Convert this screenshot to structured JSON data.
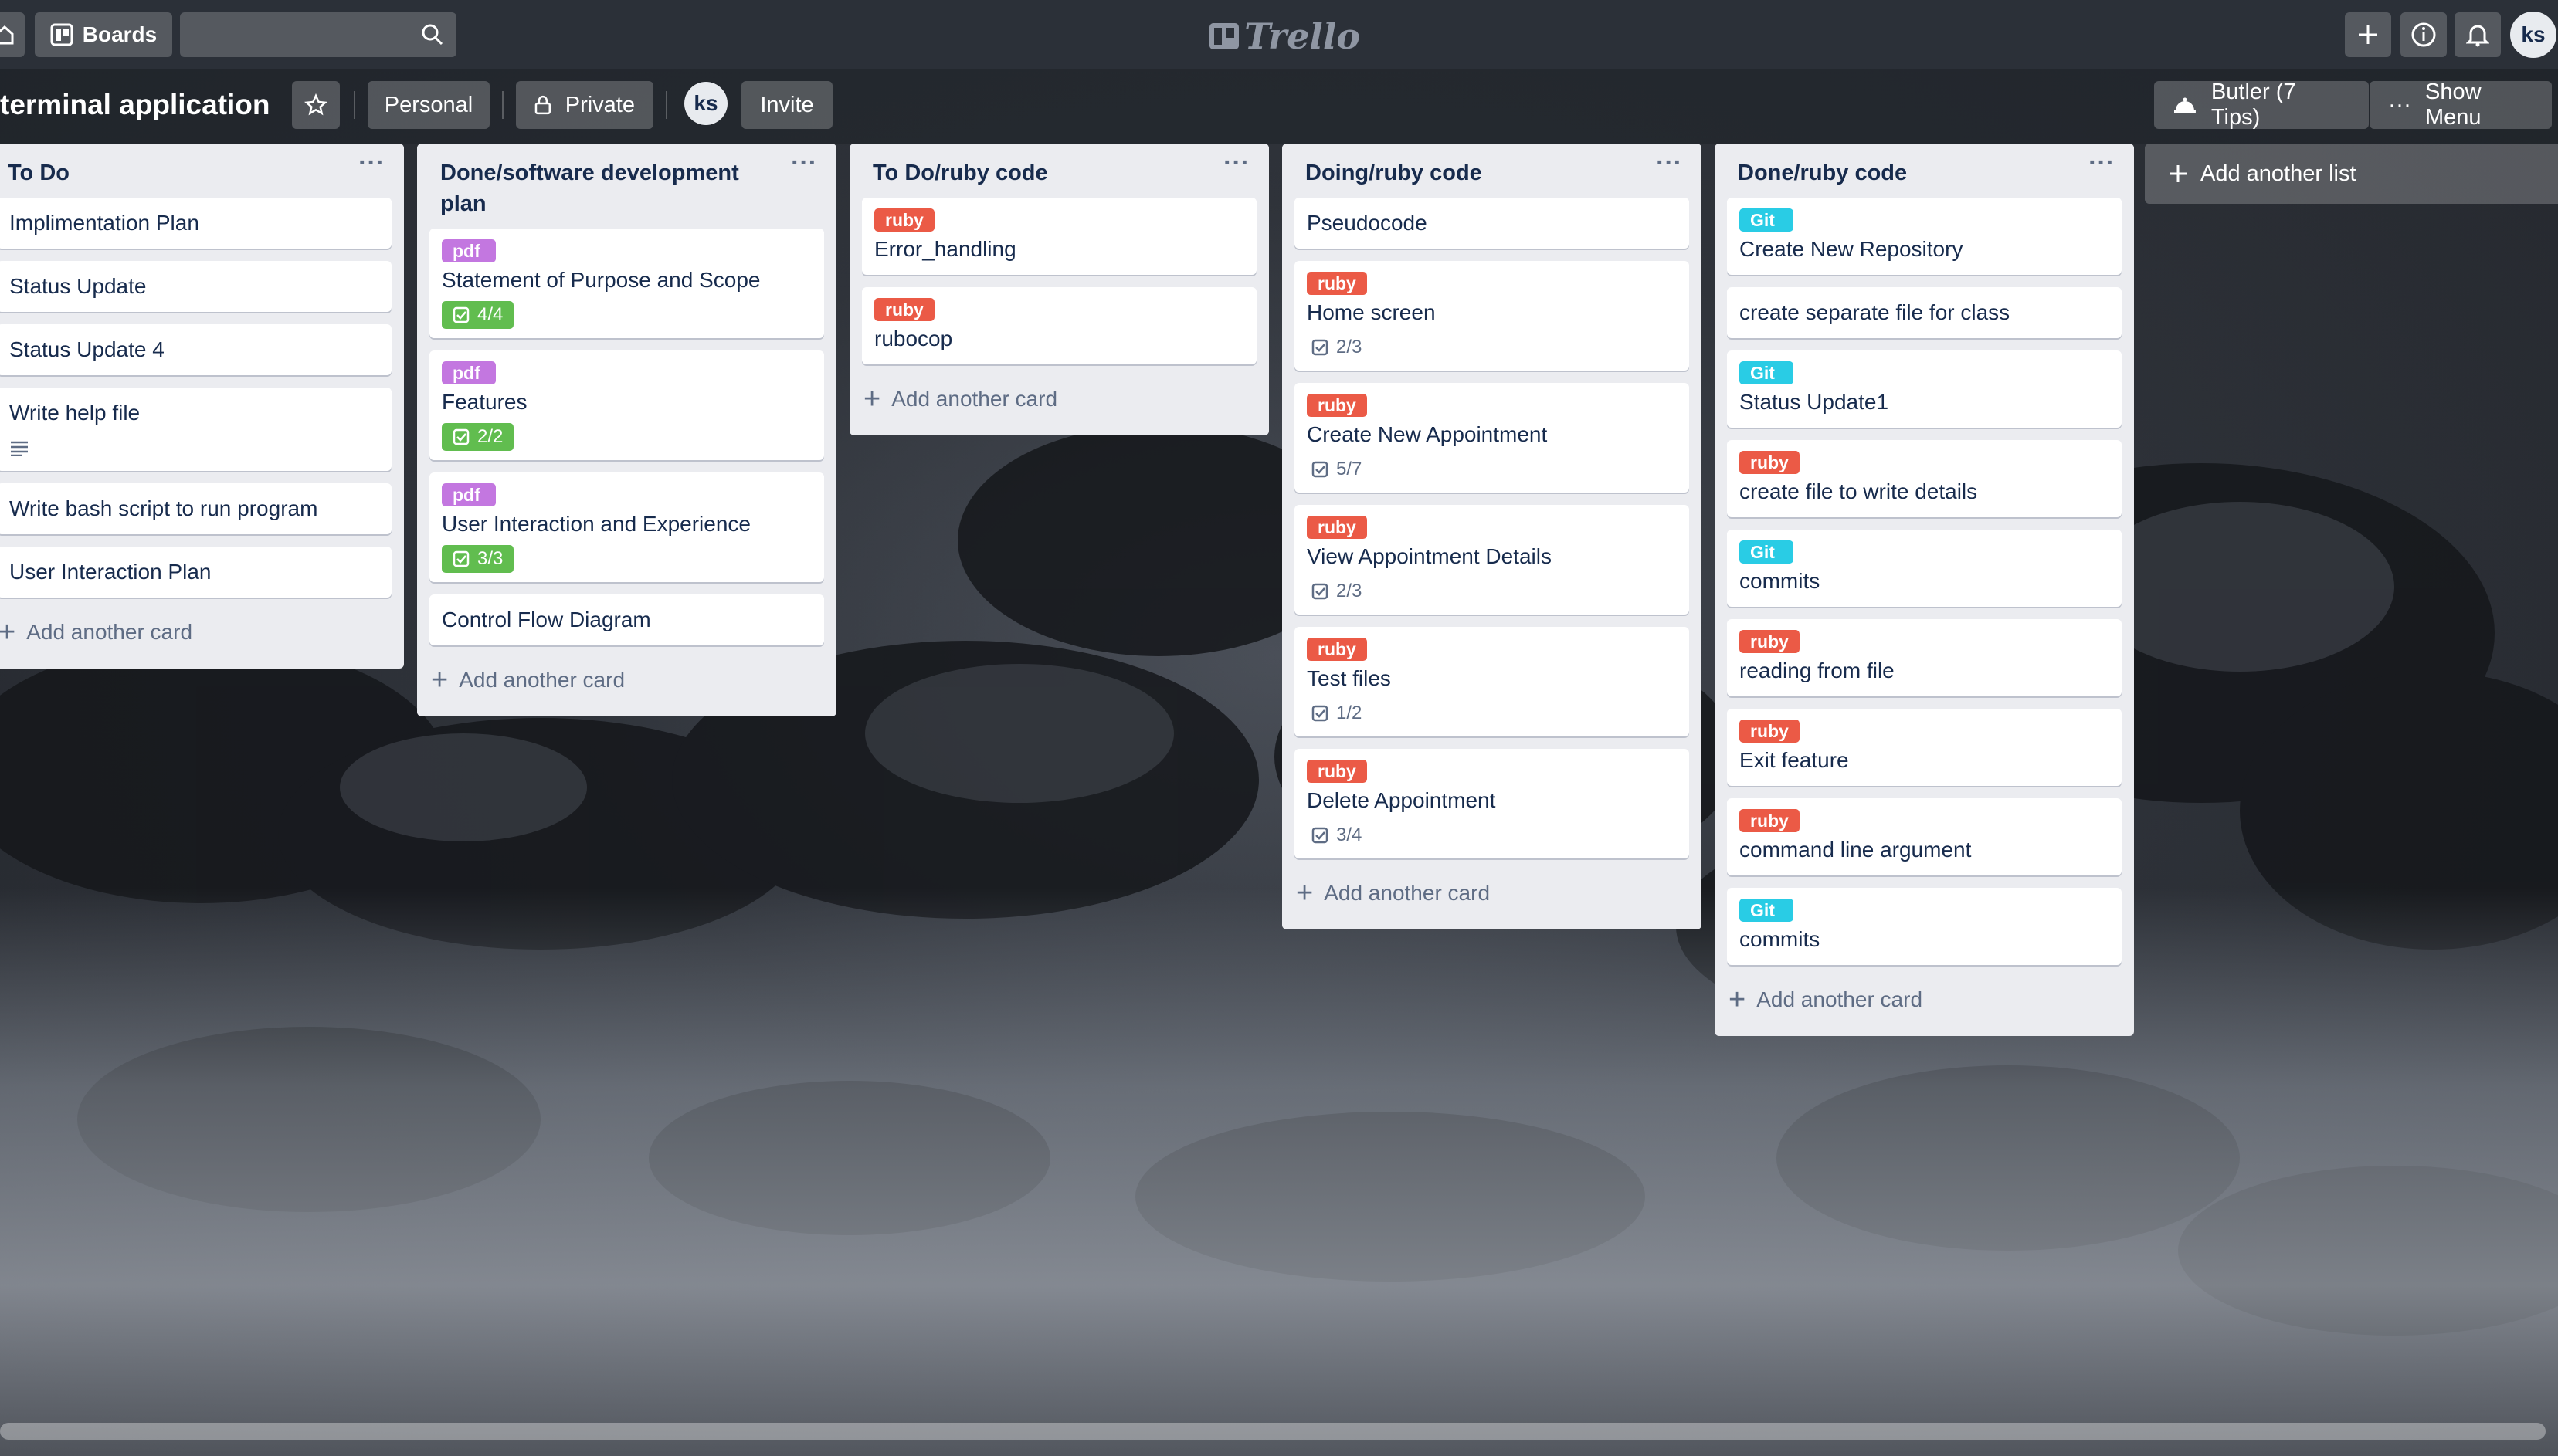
{
  "header": {
    "boards_label": "Boards",
    "logo_text": "Trello",
    "user_initials": "ks"
  },
  "board": {
    "title": "terminal application",
    "personal_label": "Personal",
    "private_label": "Private",
    "member_initials": "ks",
    "invite_label": "Invite",
    "butler_label": "Butler (7 Tips)",
    "show_menu_label": "Show Menu"
  },
  "colors": {
    "ruby": "#eb5a46",
    "pdf": "#c377e0",
    "git": "#29cce5",
    "done_badge": "#61bd4f"
  },
  "add_card_label": "Add another card",
  "add_list_label": "Add another list",
  "lists": [
    {
      "title": "To Do",
      "cards": [
        {
          "title": "Implimentation Plan"
        },
        {
          "title": "Status Update"
        },
        {
          "title": "Status Update 4"
        },
        {
          "title": "Write help file",
          "has_description": true
        },
        {
          "title": "Write bash script to run program"
        },
        {
          "title": "User Interaction Plan"
        }
      ]
    },
    {
      "title": "Done/software development plan",
      "cards": [
        {
          "label": "pdf",
          "title": "Statement of Purpose and Scope",
          "checklist": "4/4",
          "complete": true
        },
        {
          "label": "pdf",
          "title": "Features",
          "checklist": "2/2",
          "complete": true
        },
        {
          "label": "pdf",
          "title": "User Interaction and Experience",
          "checklist": "3/3",
          "complete": true
        },
        {
          "title": "Control Flow Diagram"
        }
      ]
    },
    {
      "title": "To Do/ruby code",
      "cards": [
        {
          "label": "ruby",
          "title": "Error_handling"
        },
        {
          "label": "ruby",
          "title": "rubocop"
        }
      ]
    },
    {
      "title": "Doing/ruby code",
      "cards": [
        {
          "title": "Pseudocode"
        },
        {
          "label": "ruby",
          "title": "Home screen",
          "checklist": "2/3"
        },
        {
          "label": "ruby",
          "title": "Create New Appointment",
          "checklist": "5/7"
        },
        {
          "label": "ruby",
          "title": "View Appointment Details",
          "checklist": "2/3"
        },
        {
          "label": "ruby",
          "title": "Test files",
          "checklist": "1/2"
        },
        {
          "label": "ruby",
          "title": "Delete Appointment",
          "checklist": "3/4"
        }
      ]
    },
    {
      "title": "Done/ruby code",
      "cards": [
        {
          "label": "Git",
          "title": "Create New Repository"
        },
        {
          "title": "create separate file for class"
        },
        {
          "label": "Git",
          "title": "Status Update1"
        },
        {
          "label": "ruby",
          "title": "create file to write details"
        },
        {
          "label": "Git",
          "title": "commits"
        },
        {
          "label": "ruby",
          "title": "reading from file"
        },
        {
          "label": "ruby",
          "title": "Exit feature"
        },
        {
          "label": "ruby",
          "title": "command line argument"
        },
        {
          "label": "Git",
          "title": "commits"
        }
      ]
    }
  ]
}
